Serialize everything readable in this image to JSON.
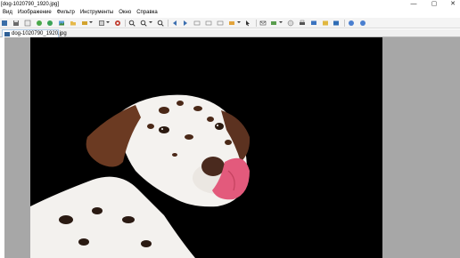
{
  "window": {
    "title": "[dog-1020790_1920.jpg]",
    "controls": [
      "—",
      "▢",
      "✕"
    ]
  },
  "menu": [
    "Вид",
    "Изображение",
    "Фильтр",
    "Инструменты",
    "Окно",
    "Справка"
  ],
  "toolbar": {
    "icons": [
      "open-icon",
      "save-icon",
      "print-preview-icon",
      "refresh-icon",
      "back-icon",
      "image-icon",
      "open-folder-icon",
      "adjust-icon",
      "colors-icon",
      "zoom-in-icon",
      "zoom-out-icon",
      "zoom-fit-icon",
      "prev-icon",
      "next-icon",
      "slideshow-icon",
      "fullscreen-icon",
      "copy-icon",
      "paste-icon",
      "email-icon",
      "scan-icon",
      "crop-icon",
      "print-icon",
      "monitor-icon",
      "settings-icon",
      "about-icon",
      "help-icon"
    ]
  },
  "tab": {
    "label": "dog-1020790_1920.jpg"
  },
  "image": {
    "alt": "Dalmatian",
    "background_color": "#000000",
    "canvas_color": "#a7a7a7"
  }
}
